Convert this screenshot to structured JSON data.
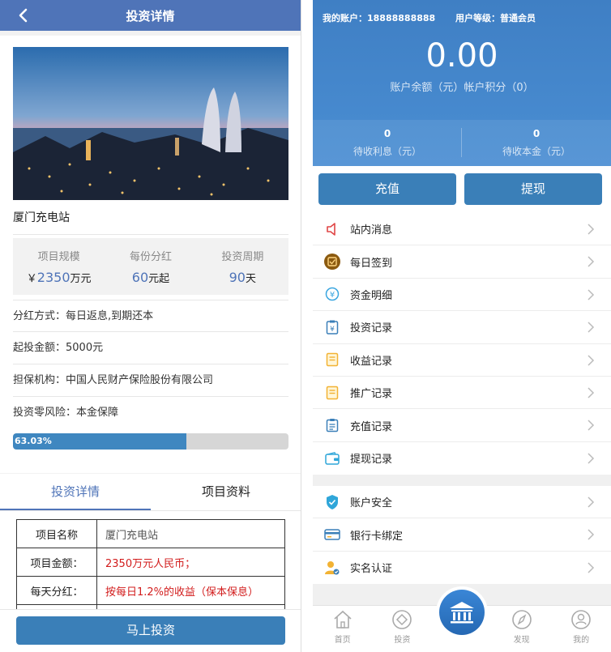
{
  "detail": {
    "title": "投资详情",
    "project_name": "厦门充电站",
    "stats": [
      {
        "label": "项目规模",
        "prefix": "￥",
        "value": "2350",
        "unit": "万元"
      },
      {
        "label": "每份分红",
        "prefix": "",
        "value": "60",
        "unit": "元起"
      },
      {
        "label": "投资周期",
        "prefix": "",
        "value": "90",
        "unit": "天"
      }
    ],
    "info": [
      "分红方式：每日返息,到期还本",
      "起投金额：5000元",
      "担保机构：中国人民财产保险股份有限公司",
      "投资零风险：本金保障"
    ],
    "progress_label": "63.03%",
    "progress_fraction": 0.6303,
    "tabs": [
      "投资详情",
      "项目资料"
    ],
    "table": [
      {
        "k": "项目名称",
        "v": "厦门充电站"
      },
      {
        "k": "项目金额：",
        "v": "2350万元人民币；"
      },
      {
        "k": "每天分红：",
        "v": "按每日1.2%的收益（保本保息）"
      }
    ],
    "invest_button": "马上投资"
  },
  "account": {
    "my_account": "我的账户：18888888888",
    "user_level": "用户等级：普通会员",
    "balance": "0.00",
    "balance_label": "账户余额（元）帐户积分（0）",
    "pending_interest": "0",
    "pending_interest_label": "待收利息（元）",
    "pending_principal": "0",
    "pending_principal_label": "待收本金（元）",
    "recharge": "充值",
    "withdraw": "提现"
  },
  "menu1": [
    {
      "label": "站内消息",
      "icon": "speaker-icon"
    },
    {
      "label": "每日签到",
      "icon": "checkin-icon"
    },
    {
      "label": "资金明细",
      "icon": "yen-circle-icon"
    },
    {
      "label": "投资记录",
      "icon": "yen-doc-icon"
    },
    {
      "label": "收益记录",
      "icon": "note-icon"
    },
    {
      "label": "推广记录",
      "icon": "note-icon"
    },
    {
      "label": "充值记录",
      "icon": "clipboard-icon"
    },
    {
      "label": "提现记录",
      "icon": "wallet-icon"
    }
  ],
  "menu2": [
    {
      "label": "账户安全",
      "icon": "shield-icon"
    },
    {
      "label": "银行卡绑定",
      "icon": "card-icon"
    },
    {
      "label": "实名认证",
      "icon": "user-verify-icon"
    }
  ],
  "nav": [
    "首页",
    "投资",
    "",
    "发现",
    "我的"
  ],
  "colors": {
    "primary": "#4f74b8",
    "button": "#3a7fb8",
    "red": "#d21c1c"
  }
}
